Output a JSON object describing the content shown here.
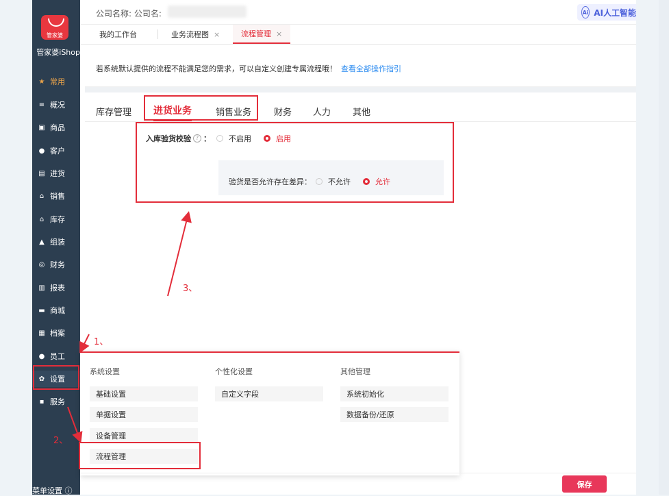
{
  "brand": {
    "logo_text": "管家婆",
    "name": "管家婆iShop"
  },
  "sidebar": {
    "items": [
      {
        "icon": "star-icon",
        "glyph": "★",
        "label": "常用"
      },
      {
        "icon": "layers-icon",
        "glyph": "≡",
        "label": "概况"
      },
      {
        "icon": "goods-icon",
        "glyph": "▣",
        "label": "商品"
      },
      {
        "icon": "customer-icon",
        "glyph": "●",
        "label": "客户"
      },
      {
        "icon": "cart-icon",
        "glyph": "▤",
        "label": "进货"
      },
      {
        "icon": "shop-icon",
        "glyph": "⌂",
        "label": "销售"
      },
      {
        "icon": "warehouse-icon",
        "glyph": "⌂",
        "label": "库存"
      },
      {
        "icon": "assembly-icon",
        "glyph": "▲",
        "label": "组装"
      },
      {
        "icon": "finance-icon",
        "glyph": "◎",
        "label": "财务"
      },
      {
        "icon": "report-icon",
        "glyph": "▥",
        "label": "报表"
      },
      {
        "icon": "mall-icon",
        "glyph": "▬",
        "label": "商城"
      },
      {
        "icon": "archive-icon",
        "glyph": "▦",
        "label": "档案"
      },
      {
        "icon": "staff-icon",
        "glyph": "●",
        "label": "员工"
      },
      {
        "icon": "gear-icon",
        "glyph": "✿",
        "label": "设置"
      },
      {
        "icon": "grid-icon",
        "glyph": "▪",
        "label": "服务"
      }
    ],
    "bottom": "菜单设置 ⓘ"
  },
  "header": {
    "company_label": "公司名称: 公司名:",
    "ai_label": "AI人工智能",
    "ai_icon": "Ai"
  },
  "tabs": [
    {
      "label": "我的工作台"
    },
    {
      "label": "业务流程图",
      "close": "×"
    },
    {
      "label": "流程管理",
      "close": "×"
    }
  ],
  "notice": {
    "text": "若系统默认提供的流程不能满足您的需求，可以自定义创建专属流程哦！",
    "link": "查看全部操作指引"
  },
  "category_tabs": [
    "库存管理",
    "进货业务",
    "销售业务",
    "财务",
    "人力",
    "其他"
  ],
  "options": {
    "inbound_check": {
      "label": "入库验货校验",
      "help": "?",
      "colon": "：",
      "off": "不启用",
      "on": "启用"
    },
    "allow_diff": {
      "label": "验货是否允许存在差异：",
      "off": "不允许",
      "on": "允许"
    }
  },
  "menu": {
    "columns": [
      {
        "title": "系统设置",
        "items": [
          "基础设置",
          "单据设置",
          "设备管理",
          "流程管理"
        ]
      },
      {
        "title": "个性化设置",
        "items": [
          "自定义字段"
        ]
      },
      {
        "title": "其他管理",
        "items": [
          "系统初始化",
          "数据备份/还原"
        ]
      }
    ]
  },
  "footer": {
    "save": "保存"
  },
  "annotations": {
    "step1": "1、",
    "step2": "2、",
    "step3": "3、"
  },
  "colors": {
    "accent": "#e32d3a",
    "sidebar": "#2c3e50",
    "link": "#2d8cf0"
  }
}
